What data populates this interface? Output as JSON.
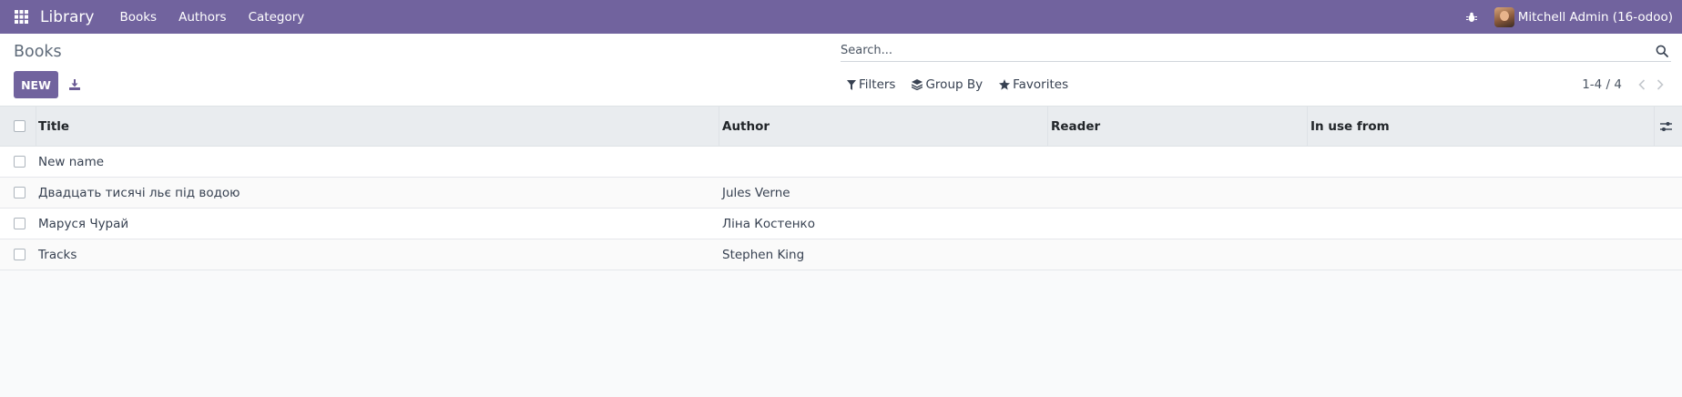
{
  "navbar": {
    "apps_icon": "grid-icon",
    "brand": "Library",
    "menu": [
      {
        "label": "Books"
      },
      {
        "label": "Authors"
      },
      {
        "label": "Category"
      }
    ],
    "debug_icon": "bug-icon",
    "user_name": "Mitchell Admin (16-odoo)",
    "color": "#71639e"
  },
  "control_panel": {
    "title": "Books",
    "new_label": "NEW",
    "download_icon": "download-icon",
    "search_placeholder": "Search...",
    "filters_label": "Filters",
    "group_by_label": "Group By",
    "favorites_label": "Favorites",
    "pager_value": "1-4 / 4"
  },
  "table": {
    "columns": [
      "Title",
      "Author",
      "Reader",
      "In use from"
    ],
    "rows": [
      {
        "title": "New name",
        "author": "",
        "reader": "",
        "in_use_from": ""
      },
      {
        "title": "Двадцать тисячі льє під водою",
        "author": "Jules Verne",
        "reader": "",
        "in_use_from": ""
      },
      {
        "title": "Маруся Чурай",
        "author": "Ліна Костенко",
        "reader": "",
        "in_use_from": ""
      },
      {
        "title": "Tracks",
        "author": "Stephen King",
        "reader": "",
        "in_use_from": ""
      }
    ]
  }
}
